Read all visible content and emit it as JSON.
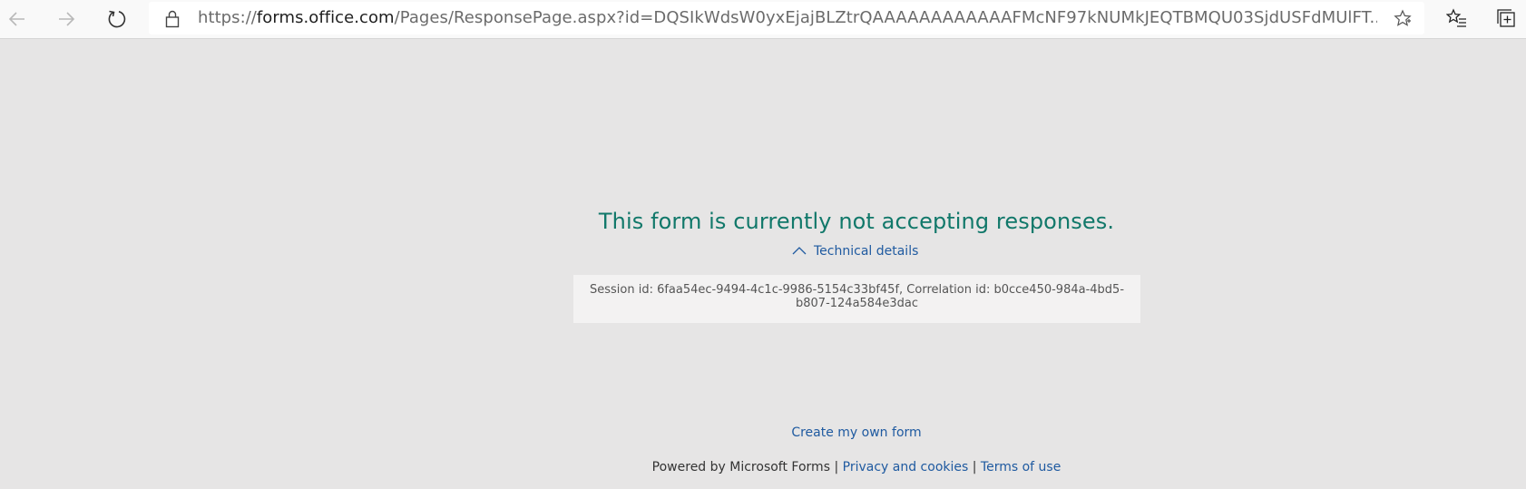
{
  "browser": {
    "url_prefix": "https://",
    "url_host": "forms.office.com",
    "url_path": "/Pages/ResponsePage.aspx?id=DQSIkWdsW0yxEjajBLZtrQAAAAAAAAAAAAFMcNF97kNUMkJEQTBMQU03SjdUSFdMUlFT..."
  },
  "page": {
    "message": "This form is currently not accepting responses.",
    "technical_details_label": "Technical details",
    "session_info": "Session id: 6faa54ec-9494-4c1c-9986-5154c33bf45f, Correlation id: b0cce450-984a-4bd5-b807-124a584e3dac",
    "create_form_link": "Create my own form"
  },
  "footer": {
    "powered_by": "Powered by Microsoft Forms",
    "separator": "|",
    "privacy_link": "Privacy and cookies",
    "terms_link": "Terms of use"
  },
  "colors": {
    "message": "#11786a",
    "link": "#1f5aa0",
    "background": "#e6e5e5"
  },
  "icons": [
    "back-arrow-icon",
    "forward-arrow-icon",
    "refresh-icon",
    "lock-icon",
    "favorite-star-icon",
    "favorites-list-icon",
    "collections-icon",
    "chevron-up-icon"
  ]
}
